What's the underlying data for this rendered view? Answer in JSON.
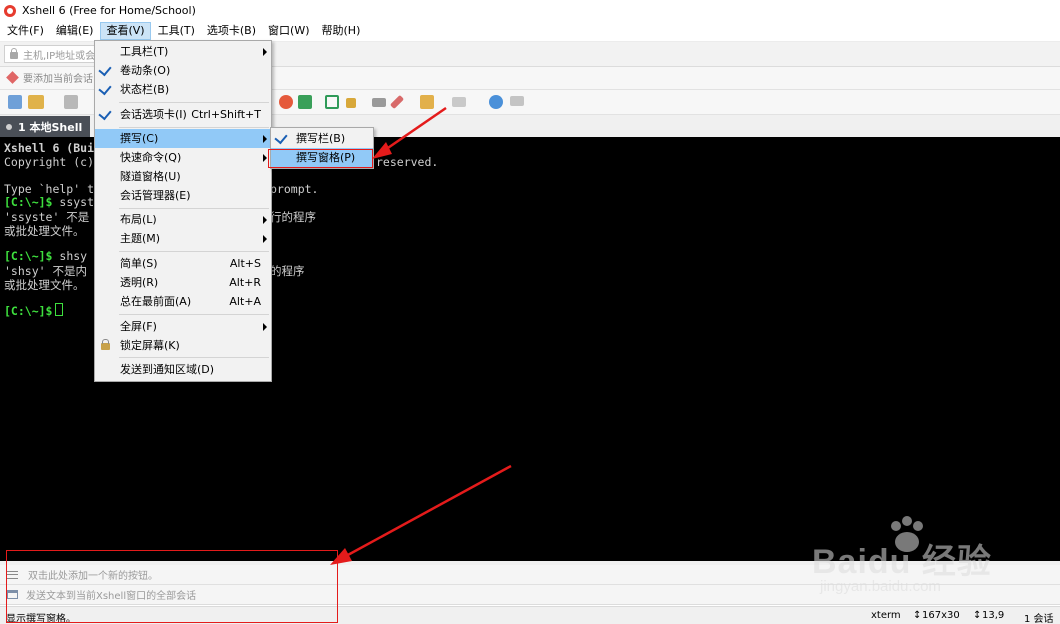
{
  "window": {
    "title": "Xshell 6 (Free for Home/School)"
  },
  "menubar": {
    "items": [
      "文件(F)",
      "编辑(E)",
      "查看(V)",
      "工具(T)",
      "选项卡(B)",
      "窗口(W)",
      "帮助(H)"
    ]
  },
  "address": {
    "placeholder": "主机,IP地址或会"
  },
  "links": {
    "text": "要添加当前会话"
  },
  "tabs": [
    {
      "label": "1 本地Shell"
    }
  ],
  "terminal": {
    "lines": [
      "Xshell 6 (Buil",
      "Copyright (c)",
      "reserved.",
      "Type `help' to",
      "prompt.",
      "ssyste",
      "'ssyste' 不是",
      "行的程序",
      "或批处理文件。",
      "shsy",
      "'shsy' 不是内",
      "的程序",
      "或批处理文件。"
    ],
    "prompt": "[C:\\~]$"
  },
  "view_menu": {
    "items": [
      {
        "label": "工具栏(T)",
        "checked": false,
        "submenu": true,
        "shortcut": ""
      },
      {
        "label": "卷动条(O)",
        "checked": true,
        "submenu": false,
        "shortcut": ""
      },
      {
        "label": "状态栏(B)",
        "checked": true,
        "submenu": false,
        "shortcut": ""
      },
      {
        "label": "会话选项卡(I)",
        "checked": true,
        "submenu": false,
        "shortcut": "Ctrl+Shift+T"
      },
      {
        "label": "撰写(C)",
        "checked": false,
        "submenu": true,
        "shortcut": "",
        "highlighted": true
      },
      {
        "label": "快速命令(Q)",
        "checked": false,
        "submenu": true,
        "shortcut": ""
      },
      {
        "label": "隧道窗格(U)",
        "checked": false,
        "submenu": false,
        "shortcut": ""
      },
      {
        "label": "会话管理器(E)",
        "checked": false,
        "submenu": false,
        "shortcut": ""
      },
      {
        "label": "布局(L)",
        "checked": false,
        "submenu": true,
        "shortcut": ""
      },
      {
        "label": "主题(M)",
        "checked": false,
        "submenu": true,
        "shortcut": ""
      },
      {
        "label": "简单(S)",
        "checked": false,
        "submenu": false,
        "shortcut": "Alt+S"
      },
      {
        "label": "透明(R)",
        "checked": false,
        "submenu": false,
        "shortcut": "Alt+R"
      },
      {
        "label": "总在最前面(A)",
        "checked": false,
        "submenu": false,
        "shortcut": "Alt+A"
      },
      {
        "label": "全屏(F)",
        "checked": false,
        "submenu": true,
        "shortcut": ""
      },
      {
        "label": "锁定屏幕(K)",
        "checked": false,
        "submenu": false,
        "shortcut": "",
        "icon": "lock-icon"
      },
      {
        "label": "发送到通知区域(D)",
        "checked": false,
        "submenu": false,
        "shortcut": ""
      }
    ]
  },
  "compose_menu": {
    "items": [
      {
        "label": "撰写栏(B)",
        "checked": true
      },
      {
        "label": "撰写窗格(P)",
        "checked": false,
        "highlighted": true
      }
    ]
  },
  "compose_area": {
    "bar_hint": "双击此处添加一个新的按钮。",
    "pane_hint": "发送文本到当前Xshell窗口的全部会话"
  },
  "statusbar": {
    "message": "显示撰写窗格。",
    "term": "xterm",
    "size": "167x30",
    "cursor": "13,9",
    "sessions": "1 会话"
  },
  "watermark": {
    "main": "Baidu 经验",
    "sub": "jingyan.baidu.com"
  },
  "colors": {
    "menu_highlight": "#91c9f7",
    "prompt_green": "#3ee03e",
    "annotation_red": "#e41b1b",
    "tab_active": "#4a4f57"
  }
}
